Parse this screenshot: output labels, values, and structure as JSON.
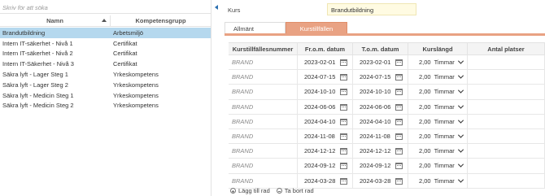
{
  "left": {
    "search_placeholder": "Skriv för att söka",
    "columns": {
      "name": "Namn",
      "group": "Kompetensgrupp"
    },
    "rows": [
      {
        "name": "Brandutbildning",
        "group": "Arbetsmiljö",
        "selected": true
      },
      {
        "name": "Intern IT-säkerhet - Nivå 1",
        "group": "Certifikat"
      },
      {
        "name": "Intern IT-säkerhet - Nivå 2",
        "group": "Certifikat"
      },
      {
        "name": "Intern IT-Säkerhet - Nivå 3",
        "group": "Certifikat"
      },
      {
        "name": "Säkra lyft - Lager Steg 1",
        "group": "Yrkeskompetens"
      },
      {
        "name": "Säkra lyft - Lager Steg 2",
        "group": "Yrkeskompetens"
      },
      {
        "name": "Säkra lyft - Medicin Steg 1",
        "group": "Yrkeskompetens"
      },
      {
        "name": "Säkra lyft - Medicin Steg 2",
        "group": "Yrkeskompetens"
      }
    ]
  },
  "right": {
    "kurs_label": "Kurs",
    "kurs_value": "Brandutbildning",
    "tabs": [
      {
        "label": "Allmänt",
        "active": false
      },
      {
        "label": "Kurstillfällen",
        "active": true
      }
    ],
    "grid_columns": {
      "id": "Kurstillfällesnummer",
      "from": "Fr.o.m. datum",
      "to": "T.o.m. datum",
      "length": "Kurslängd",
      "seats": "Antal platser"
    },
    "rows": [
      {
        "id": "BRAND",
        "from": "2023-02-01",
        "to": "2023-02-01",
        "length": "2,00",
        "unit": "Timmar"
      },
      {
        "id": "BRAND",
        "from": "2024-07-15",
        "to": "2024-07-15",
        "length": "2,00",
        "unit": "Timmar"
      },
      {
        "id": "BRAND",
        "from": "2024-10-10",
        "to": "2024-10-10",
        "length": "2,00",
        "unit": "Timmar"
      },
      {
        "id": "BRAND",
        "from": "2024-06-06",
        "to": "2024-06-06",
        "length": "2,00",
        "unit": "Timmar"
      },
      {
        "id": "BRAND",
        "from": "2024-04-10",
        "to": "2024-04-10",
        "length": "2,00",
        "unit": "Timmar"
      },
      {
        "id": "BRAND",
        "from": "2024-11-08",
        "to": "2024-11-08",
        "length": "2,00",
        "unit": "Timmar"
      },
      {
        "id": "BRAND",
        "from": "2024-12-12",
        "to": "2024-12-12",
        "length": "2,00",
        "unit": "Timmar"
      },
      {
        "id": "BRAND",
        "from": "2024-09-12",
        "to": "2024-09-12",
        "length": "2,00",
        "unit": "Timmar"
      },
      {
        "id": "BRAND",
        "from": "2024-03-28",
        "to": "2024-03-28",
        "length": "2,00",
        "unit": "Timmar"
      }
    ],
    "actions": {
      "add": "Lägg till rad",
      "remove": "Ta bort rad"
    }
  }
}
